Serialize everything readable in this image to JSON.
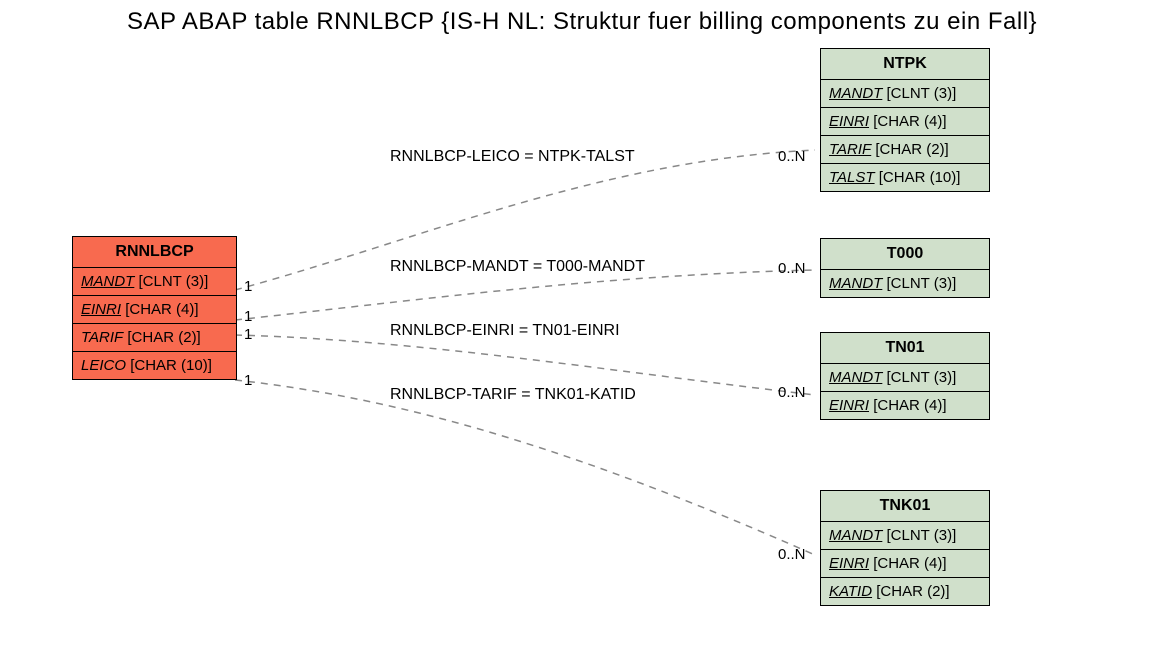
{
  "title": "SAP ABAP table RNNLBCP {IS-H NL: Struktur fuer billing components zu ein Fall}",
  "main": {
    "name": "RNNLBCP",
    "fields": [
      {
        "name": "MANDT",
        "type": "[CLNT (3)]",
        "underline": true
      },
      {
        "name": "EINRI",
        "type": "[CHAR (4)]",
        "underline": true
      },
      {
        "name": "TARIF",
        "type": "[CHAR (2)]",
        "underline": false
      },
      {
        "name": "LEICO",
        "type": "[CHAR (10)]",
        "underline": false
      }
    ]
  },
  "refs": {
    "ntpk": {
      "name": "NTPK",
      "fields": [
        {
          "name": "MANDT",
          "type": "[CLNT (3)]",
          "underline": true
        },
        {
          "name": "EINRI",
          "type": "[CHAR (4)]",
          "underline": true
        },
        {
          "name": "TARIF",
          "type": "[CHAR (2)]",
          "underline": true
        },
        {
          "name": "TALST",
          "type": "[CHAR (10)]",
          "underline": true
        }
      ]
    },
    "t000": {
      "name": "T000",
      "fields": [
        {
          "name": "MANDT",
          "type": "[CLNT (3)]",
          "underline": true
        }
      ]
    },
    "tn01": {
      "name": "TN01",
      "fields": [
        {
          "name": "MANDT",
          "type": "[CLNT (3)]",
          "underline": true
        },
        {
          "name": "EINRI",
          "type": "[CHAR (4)]",
          "underline": true
        }
      ]
    },
    "tnk01": {
      "name": "TNK01",
      "fields": [
        {
          "name": "MANDT",
          "type": "[CLNT (3)]",
          "underline": true
        },
        {
          "name": "EINRI",
          "type": "[CHAR (4)]",
          "underline": true
        },
        {
          "name": "KATID",
          "type": "[CHAR (2)]",
          "underline": true
        }
      ]
    }
  },
  "relations": {
    "r1": {
      "label": "RNNLBCP-LEICO = NTPK-TALST",
      "left": "1",
      "right": "0..N"
    },
    "r2": {
      "label": "RNNLBCP-MANDT = T000-MANDT",
      "left": "1",
      "right": "0..N"
    },
    "r3": {
      "label": "RNNLBCP-EINRI = TN01-EINRI",
      "left": "1",
      "right": ""
    },
    "r4": {
      "label": "RNNLBCP-TARIF = TNK01-KATID",
      "left": "1",
      "right": "0..N"
    },
    "r5": {
      "label": "",
      "left": "",
      "right": "0..N"
    }
  }
}
